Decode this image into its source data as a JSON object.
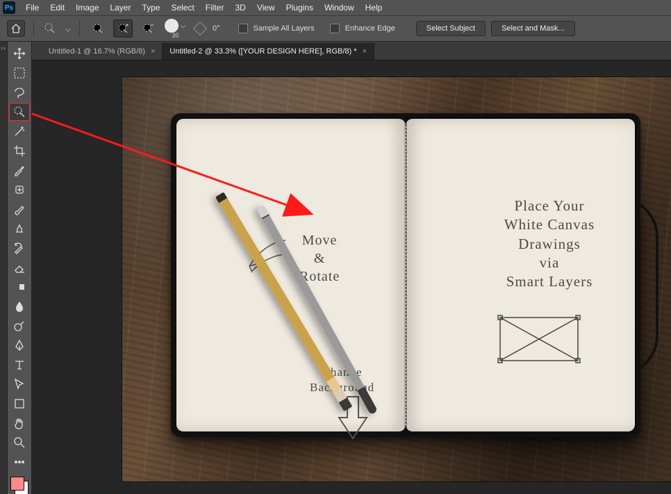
{
  "menu": {
    "items": [
      "File",
      "Edit",
      "Image",
      "Layer",
      "Type",
      "Select",
      "Filter",
      "3D",
      "View",
      "Plugins",
      "Window",
      "Help"
    ],
    "logo": "Ps"
  },
  "options": {
    "brush_size": "30",
    "angle": "0°",
    "sample_all_layers": "Sample All Layers",
    "enhance_edge": "Enhance Edge",
    "select_subject": "Select Subject",
    "select_and_mask": "Select and Mask..."
  },
  "tabs": [
    {
      "label": "Untitled-1 @ 16.7% (RGB/8)",
      "active": false
    },
    {
      "label": "Untitled-2 @ 33.3% ([YOUR DESIGN HERE], RGB/8) *",
      "active": true
    }
  ],
  "tools": [
    {
      "name": "move-tool"
    },
    {
      "name": "marquee-tool"
    },
    {
      "name": "lasso-tool"
    },
    {
      "name": "quick-selection-tool",
      "selected": true
    },
    {
      "name": "magic-wand-tool"
    },
    {
      "name": "crop-tool"
    },
    {
      "name": "eyedropper-tool"
    },
    {
      "name": "healing-brush-tool"
    },
    {
      "name": "brush-tool"
    },
    {
      "name": "clone-stamp-tool"
    },
    {
      "name": "history-brush-tool"
    },
    {
      "name": "eraser-tool"
    },
    {
      "name": "gradient-tool"
    },
    {
      "name": "blur-tool"
    },
    {
      "name": "dodge-tool"
    },
    {
      "name": "pen-tool"
    },
    {
      "name": "type-tool"
    },
    {
      "name": "path-selection-tool"
    },
    {
      "name": "shape-tool"
    },
    {
      "name": "hand-tool"
    },
    {
      "name": "zoom-tool"
    },
    {
      "name": "more-tools"
    }
  ],
  "notebook": {
    "left_text_1": "Move\n&\nRotate",
    "left_text_2": "Change\nBackground",
    "right_text": "Place Your\nWhite Canvas\nDrawings\nvia\nSmart Layers"
  },
  "swatch": {
    "fg": "#ff8a8a",
    "bg": "#ffffff"
  }
}
